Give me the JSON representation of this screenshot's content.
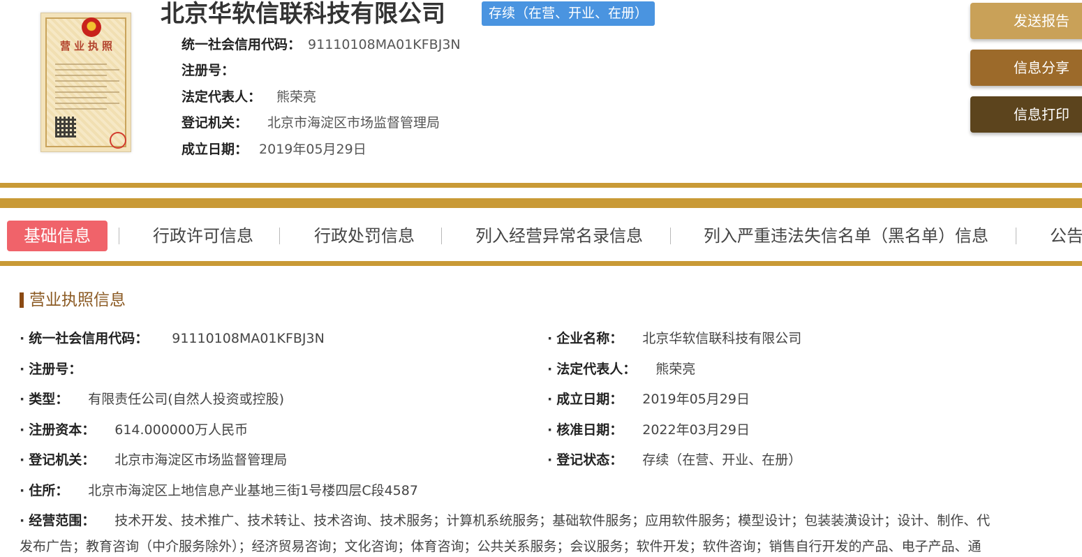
{
  "header": {
    "company_name": "北京华软信联科技有限公司",
    "status_badge": "存续（在营、开业、在册）",
    "license_title": "营业执照",
    "info": [
      {
        "label": "统一社会信用代码：",
        "value": "91110108MA01KFBJ3N"
      },
      {
        "label": "注册号：",
        "value": ""
      },
      {
        "label": "法定代表人：",
        "value": "熊荣亮"
      },
      {
        "label": "登记机关：",
        "value": "北京市海淀区市场监督管理局"
      },
      {
        "label": "成立日期：",
        "value": "2019年05月29日"
      }
    ]
  },
  "actions": {
    "report": "发送报告",
    "share": "信息分享",
    "print": "信息打印"
  },
  "tabs": [
    {
      "label": "基础信息",
      "active": true
    },
    {
      "label": "行政许可信息",
      "active": false
    },
    {
      "label": "行政处罚信息",
      "active": false
    },
    {
      "label": "列入经营异常名录信息",
      "active": false
    },
    {
      "label": "列入严重违法失信名单（黑名单）信息",
      "active": false
    },
    {
      "label": "公告",
      "active": false
    }
  ],
  "section": {
    "title": "营业执照信息",
    "bullet": "·",
    "left_fields": [
      {
        "label": "统一社会信用代码：",
        "value": "91110108MA01KFBJ3N"
      },
      {
        "label": "注册号：",
        "value": ""
      },
      {
        "label": "类型：",
        "value": "有限责任公司(自然人投资或控股)"
      },
      {
        "label": "注册资本：",
        "value": "614.000000万人民币"
      },
      {
        "label": "登记机关：",
        "value": "北京市海淀区市场监督管理局"
      },
      {
        "label": "住所：",
        "value": "北京市海淀区上地信息产业基地三街1号楼四层C段4587"
      }
    ],
    "right_fields": [
      {
        "label": "企业名称：",
        "value": "北京华软信联科技有限公司"
      },
      {
        "label": "法定代表人：",
        "value": "熊荣亮"
      },
      {
        "label": "成立日期：",
        "value": "2019年05月29日"
      },
      {
        "label": "核准日期：",
        "value": "2022年03月29日"
      },
      {
        "label": "登记状态：",
        "value": "存续（在营、开业、在册）"
      }
    ],
    "scope": {
      "label": "经营范围：",
      "line1": "技术开发、技术推广、技术转让、技术咨询、技术服务；计算机系统服务；基础软件服务；应用软件服务；模型设计；包装装潢设计；设计、制作、代",
      "line2": "发布广告；教育咨询（中介服务除外）；经济贸易咨询；文化咨询；体育咨询；公共关系服务；会议服务；软件开发；软件咨询；销售自行开发的产品、电子产品、通"
    }
  }
}
